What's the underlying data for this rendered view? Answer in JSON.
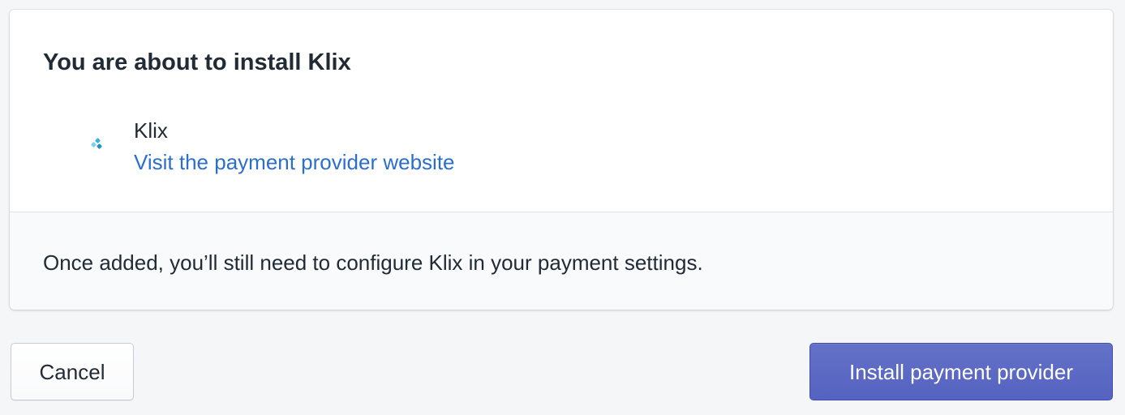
{
  "dialog": {
    "title": "You are about to install Klix",
    "provider": {
      "name": "Klix",
      "link_label": "Visit the payment provider website",
      "logo_icon": "klix-logo-icon"
    },
    "footer_note": "Once added, you’ll still need to configure Klix in your payment settings."
  },
  "actions": {
    "cancel_label": "Cancel",
    "install_label": "Install payment provider"
  },
  "colors": {
    "primary": "#5c6ac4",
    "link": "#2c6ecb",
    "text": "#212b36",
    "background": "#f4f6f8"
  }
}
